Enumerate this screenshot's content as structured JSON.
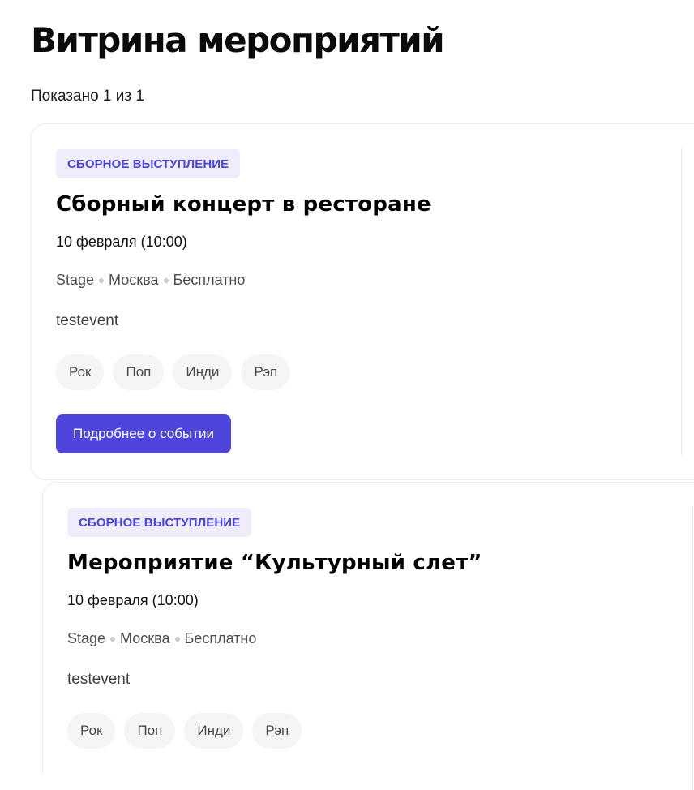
{
  "page": {
    "title": "Витрина мероприятий",
    "results_count": "Показано 1 из 1"
  },
  "events": [
    {
      "category": "СБОРНОЕ ВЫСТУПЛЕНИЕ",
      "title": "Сборный концерт в ресторане",
      "date": "10 февраля (10:00)",
      "venue": "Stage",
      "city": "Москва",
      "price": "Бесплатно",
      "description": "testevent",
      "tags": [
        "Рок",
        "Поп",
        "Инди",
        "Рэп"
      ],
      "button_label": "Подробнее о событии"
    },
    {
      "category": "СБОРНОЕ ВЫСТУПЛЕНИЕ",
      "title": "Мероприятие “Культурный слет”",
      "date": "10 февраля (10:00)",
      "venue": "Stage",
      "city": "Москва",
      "price": "Бесплатно",
      "description": "testevent",
      "tags": [
        "Рок",
        "Поп",
        "Инди",
        "Рэп"
      ]
    }
  ],
  "colors": {
    "accent": "#4e46dc",
    "badge_bg": "#efedfb",
    "badge_text": "#4b45d6"
  }
}
